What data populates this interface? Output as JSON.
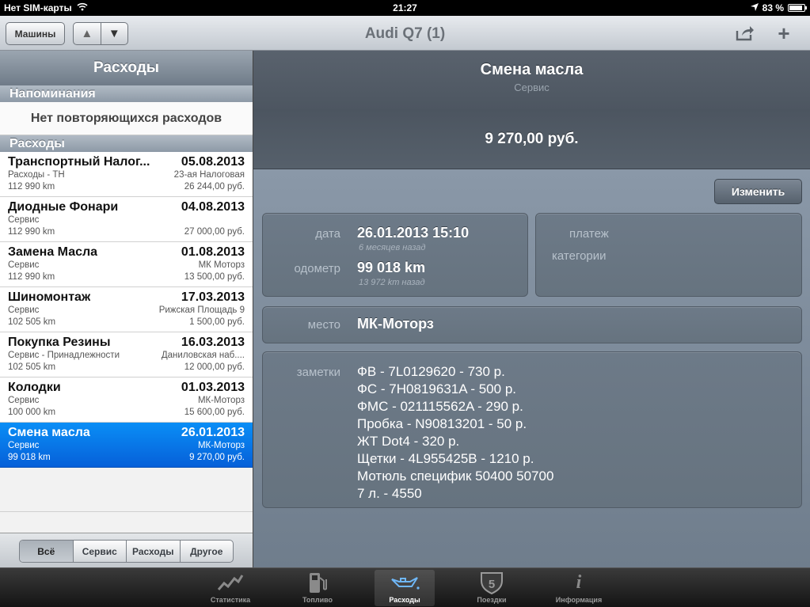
{
  "status": {
    "carrier": "Нет SIM-карты",
    "time": "21:27",
    "battery": "83 %",
    "battery_level": 0.83
  },
  "nav": {
    "machines_label": "Машины",
    "up_label": "▲",
    "down_label": "▼",
    "title": "Audi Q7 (1)",
    "share_icon": "share-icon",
    "add_label": "+"
  },
  "left": {
    "header": "Расходы",
    "reminders_header": "Напоминания",
    "no_recurring": "Нет повторяющихся расходов",
    "expenses_header": "Расходы",
    "rows": [
      {
        "name": "Транспортный Налог...",
        "date": "05.08.2013",
        "category": "Расходы - ТН",
        "place": "23-ая Налоговая",
        "odometer": "112 990 km",
        "cost": "26 244,00 руб."
      },
      {
        "name": "Диодные Фонари",
        "date": "04.08.2013",
        "category": "Сервис",
        "place": "",
        "odometer": "112 990 km",
        "cost": "27 000,00 руб."
      },
      {
        "name": "Замена Масла",
        "date": "01.08.2013",
        "category": "Сервис",
        "place": "МК Моторз",
        "odometer": "112 990 km",
        "cost": "13 500,00 руб."
      },
      {
        "name": "Шиномонтаж",
        "date": "17.03.2013",
        "category": "Сервис",
        "place": "Рижская Площадь 9",
        "odometer": "102 505 km",
        "cost": "1 500,00 руб."
      },
      {
        "name": "Покупка Резины",
        "date": "16.03.2013",
        "category": "Сервис - Принадлежности",
        "place": "Даниловская наб....",
        "odometer": "102 505 km",
        "cost": "12 000,00 руб."
      },
      {
        "name": "Колодки",
        "date": "01.03.2013",
        "category": "Сервис",
        "place": "МК-Моторз",
        "odometer": "100 000 km",
        "cost": "15 600,00 руб."
      },
      {
        "name": "Смена масла",
        "date": "26.01.2013",
        "category": "Сервис",
        "place": "МК-Моторз",
        "odometer": "99 018 km",
        "cost": "9 270,00 руб."
      }
    ],
    "filters": [
      "Всё",
      "Сервис",
      "Расходы",
      "Другое"
    ]
  },
  "detail": {
    "title": "Смена масла",
    "subtitle": "Сервис",
    "cost": "9 270,00 руб.",
    "edit_label": "Изменить",
    "date_label": "дата",
    "date_value": "26.01.2013 15:10",
    "date_hint": "6 месяцев назад",
    "odometer_label": "одометр",
    "odometer_value": "99 018 km",
    "odometer_hint": "13 972 km назад",
    "payment_label": "платеж",
    "categories_label": "категории",
    "place_label": "место",
    "place_value": "МК-Моторз",
    "notes_label": "заметки",
    "notes": [
      "ФВ - 7L0129620 - 730 р.",
      "ФС - 7H0819631A - 500 р.",
      "ФМС - 021115562A - 290 р.",
      "Пробка - N90813201 - 50 р.",
      "ЖТ Dot4 - 320 р.",
      "Щетки - 4L955425B - 1210 р.",
      "Мотюль специфик 50400 50700",
      "7 л. - 4550"
    ]
  },
  "tabs": [
    {
      "label": "Статистика",
      "icon": "chart-icon"
    },
    {
      "label": "Топливо",
      "icon": "fuel-pump-icon"
    },
    {
      "label": "Расходы",
      "icon": "oil-can-icon"
    },
    {
      "label": "Поездки",
      "icon": "route-shield-icon",
      "badge": "5"
    },
    {
      "label": "Информация",
      "icon": "info-icon"
    }
  ]
}
